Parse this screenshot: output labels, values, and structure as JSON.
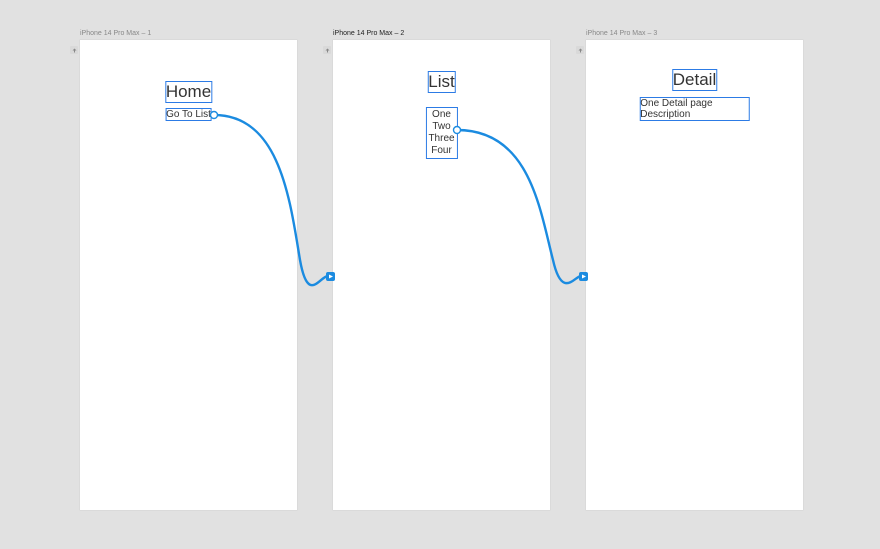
{
  "frames": {
    "one": {
      "label": "iPhone 14 Pro Max – 1"
    },
    "two": {
      "label": "iPhone 14 Pro Max – 2"
    },
    "three": {
      "label": "iPhone 14 Pro Max – 3"
    }
  },
  "screen1": {
    "title": "Home",
    "link": "Go To List"
  },
  "screen2": {
    "title": "List",
    "items": [
      "One",
      "Two",
      "Three",
      "Four"
    ]
  },
  "screen3": {
    "title": "Detail",
    "description": "One Detail page Description"
  }
}
